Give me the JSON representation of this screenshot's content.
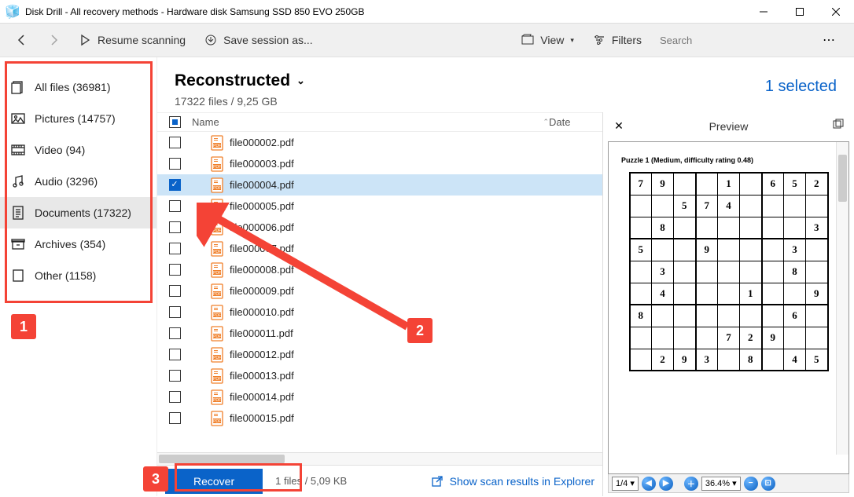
{
  "window": {
    "title": "Disk Drill - All recovery methods - Hardware disk Samsung SSD 850 EVO 250GB"
  },
  "toolbar": {
    "resume": "Resume scanning",
    "save_session": "Save session as...",
    "view": "View",
    "filters": "Filters",
    "search_placeholder": "Search"
  },
  "sidebar": {
    "items": [
      {
        "label": "All files (36981)"
      },
      {
        "label": "Pictures (14757)"
      },
      {
        "label": "Video (94)"
      },
      {
        "label": "Audio (3296)"
      },
      {
        "label": "Documents (17322)"
      },
      {
        "label": "Archives (354)"
      },
      {
        "label": "Other (1158)"
      }
    ]
  },
  "main": {
    "title": "Reconstructed",
    "subtitle": "17322 files / 9,25 GB",
    "selected_label": "1 selected",
    "columns": {
      "name": "Name",
      "date": "Date"
    },
    "files": [
      {
        "name": "file000002.pdf",
        "checked": false
      },
      {
        "name": "file000003.pdf",
        "checked": false
      },
      {
        "name": "file000004.pdf",
        "checked": true,
        "selected": true
      },
      {
        "name": "file000005.pdf",
        "checked": false
      },
      {
        "name": "file000006.pdf",
        "checked": false
      },
      {
        "name": "file000007.pdf",
        "checked": false
      },
      {
        "name": "file000008.pdf",
        "checked": false
      },
      {
        "name": "file000009.pdf",
        "checked": false
      },
      {
        "name": "file000010.pdf",
        "checked": false
      },
      {
        "name": "file000011.pdf",
        "checked": false
      },
      {
        "name": "file000012.pdf",
        "checked": false
      },
      {
        "name": "file000013.pdf",
        "checked": false
      },
      {
        "name": "file000014.pdf",
        "checked": false
      },
      {
        "name": "file000015.pdf",
        "checked": false
      }
    ]
  },
  "footer": {
    "recover": "Recover",
    "count": "1 files / 5,09 KB",
    "explorer": "Show scan results in Explorer"
  },
  "preview": {
    "title": "Preview",
    "puzzle_title": "Puzzle 1 (Medium, difficulty rating 0.48)",
    "sudoku": [
      [
        "7",
        "9",
        "",
        "",
        "1",
        "",
        "6",
        "5",
        "2"
      ],
      [
        "",
        "",
        "5",
        "7",
        "4",
        "",
        "",
        "",
        ""
      ],
      [
        "",
        "8",
        "",
        "",
        "",
        "",
        "",
        "",
        "3"
      ],
      [
        "5",
        "",
        "",
        "9",
        "",
        "",
        "",
        "3",
        ""
      ],
      [
        "",
        "3",
        "",
        "",
        "",
        "",
        "",
        "8",
        ""
      ],
      [
        "",
        "4",
        "",
        "",
        "",
        "1",
        "",
        "",
        "9"
      ],
      [
        "8",
        "",
        "",
        "",
        "",
        "",
        "",
        "6",
        ""
      ],
      [
        "",
        "",
        "",
        "",
        "7",
        "2",
        "9",
        "",
        ""
      ],
      [
        "",
        "2",
        "9",
        "3",
        "",
        "8",
        "",
        "4",
        "5"
      ]
    ],
    "page": "1/4",
    "zoom": "36.4%"
  },
  "callouts": {
    "c1": "1",
    "c2": "2",
    "c3": "3"
  }
}
